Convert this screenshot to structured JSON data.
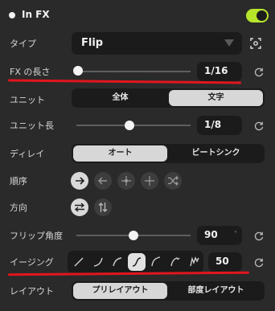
{
  "header": {
    "title": "In FX",
    "enabled": true
  },
  "type": {
    "label": "タイプ",
    "value": "Flip"
  },
  "fx_length": {
    "label": "FX の長さ",
    "value": "1/16",
    "level": 0.0
  },
  "unit": {
    "label": "ユニット",
    "options": [
      "全体",
      "文字"
    ],
    "selected": "文字"
  },
  "unit_length": {
    "label": "ユニット長",
    "value": "1/8",
    "level": 0.46
  },
  "delay": {
    "label": "ディレイ",
    "options": [
      "オート",
      "ビートシンク"
    ],
    "selected": "オート"
  },
  "order": {
    "label": "順序",
    "icons": [
      "arrow-right-icon",
      "arrow-left-icon",
      "center-out-icon",
      "edges-in-icon",
      "shuffle-icon"
    ]
  },
  "direction": {
    "label": "方向",
    "icons": [
      "horizontal-flip-icon",
      "vertical-flip-icon"
    ]
  },
  "flip_angle": {
    "label": "フリップ角度",
    "value": "90",
    "level": 0.5
  },
  "easing": {
    "label": "イージング",
    "value": "50",
    "icons": [
      "linear-ease-icon",
      "ease-in-icon",
      "ease-out-icon",
      "ease-in-out-icon",
      "back-ease-icon",
      "bounce-ease-icon",
      "elastic-ease-icon"
    ]
  },
  "layout": {
    "label": "レイアウト",
    "options": [
      "プリレイアウト",
      "部度レイアウト"
    ],
    "selected": "プリレイアウト"
  },
  "colors": {
    "accent": "#b7e52a",
    "annotation": "#e1161d",
    "panel": "#2a2a2a",
    "field": "#1b1b1b"
  }
}
